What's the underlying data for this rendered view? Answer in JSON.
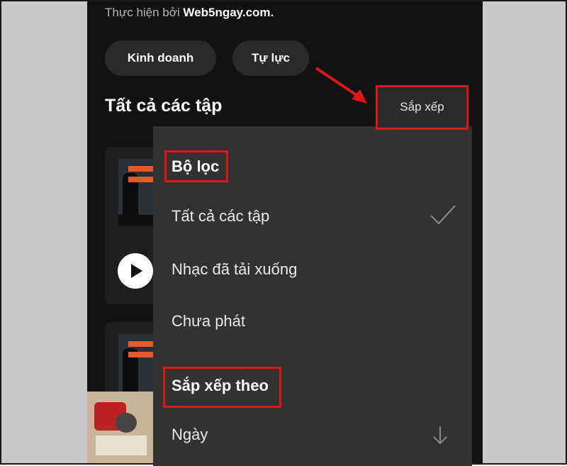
{
  "header": {
    "byline_prefix": "Thực hiện bởi",
    "byline_brand": "Web5ngay.com."
  },
  "chips": [
    "Kinh doanh",
    "Tự lực"
  ],
  "section": {
    "title": "Tất cả các tập",
    "sort_button": "Sắp xếp"
  },
  "menu": {
    "filter_heading": "Bộ lọc",
    "filter_items": [
      "Tất cả các tập",
      "Nhạc đã tải xuống",
      "Chưa phát"
    ],
    "sort_heading": "Sắp xếp theo",
    "sort_items": [
      "Ngày"
    ]
  },
  "icons": {
    "selected": "checkmark-icon",
    "sort_direction": "arrow-down-icon",
    "play": "play-icon"
  },
  "colors": {
    "background": "#121212",
    "menu": "#323232",
    "highlight": "#e0141b"
  }
}
